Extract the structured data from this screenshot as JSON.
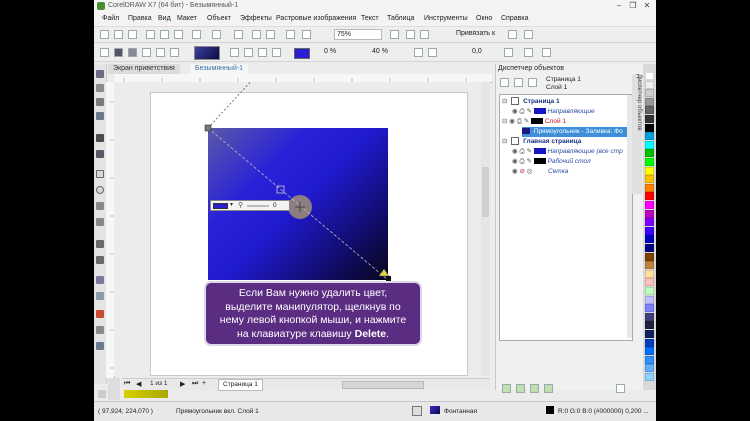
{
  "window": {
    "title": "CorelDRAW X7 (64 бит) - Безымянный-1",
    "controls": [
      "–",
      "❐",
      "✕"
    ]
  },
  "menu": [
    "Файл",
    "Правка",
    "Вид",
    "Макет",
    "Объект",
    "Эффекты",
    "Растровые изображения",
    "Текст",
    "Таблица",
    "Инструменты",
    "Окно",
    "Справка"
  ],
  "toolbar": {
    "zoom": "75%",
    "snap_label": "Привязать к",
    "angle": "0,0",
    "transparency_pct": "0 %",
    "midpoint_pct": "40 %"
  },
  "tabs": [
    "Экран приветствия",
    "Безымянный-1"
  ],
  "canvas": {
    "interactive_value": "0",
    "tooltip_lines": [
      "Если Вам нужно удалить цвет,",
      "выделите манипулятор, щелкнув по",
      "нему левой кнопкой мыши, и нажмите",
      "на клавиатуре клавишу"
    ],
    "tooltip_key": "Delete",
    "tooltip_end": "."
  },
  "navigator": {
    "page_count": "1 из 1",
    "page_tab": "Страница 1"
  },
  "docker": {
    "title": "Диспетчер объектов",
    "page_header": "Страница 1",
    "layer_header": "Слой 1",
    "vertical_tab": "Диспетчер объектов",
    "tree": [
      {
        "label": "Страница 1",
        "bold": true,
        "color": "#1a2f80"
      },
      {
        "label": "Направляющие",
        "italic": true,
        "color": "#2b4aa8",
        "swatch": "#1616c9"
      },
      {
        "label": "Слой 1",
        "color": "#c8102e",
        "swatch": "#000000"
      },
      {
        "label": "Прямоугольник - Заливка: Фо",
        "color": "#ffffff",
        "selected": true
      },
      {
        "label": "Главная страница",
        "bold": true,
        "color": "#1a2f80"
      },
      {
        "label": "Направляющие (все стр",
        "italic": true,
        "color": "#2b4aa8",
        "swatch": "#1616c9"
      },
      {
        "label": "Рабочий стол",
        "italic": true,
        "color": "#2b4aa8",
        "swatch": "#000000"
      },
      {
        "label": "Сетка",
        "italic": true,
        "color": "#2b4aa8"
      }
    ]
  },
  "palette": [
    "#ffffff",
    "#eeeeee",
    "#cccccc",
    "#999999",
    "#666666",
    "#333333",
    "#000000",
    "#00a0e3",
    "#00ffff",
    "#00c000",
    "#00ff00",
    "#ffff00",
    "#ffc000",
    "#ff8000",
    "#ff0000",
    "#ff00ff",
    "#c000c0",
    "#8000ff",
    "#4000ff",
    "#0000c0",
    "#000080",
    "#804000",
    "#c08040",
    "#ffe0a0",
    "#ffc0c0",
    "#c0ffc0",
    "#c0c0ff",
    "#8080ff",
    "#404080",
    "#202040",
    "#102060",
    "#0040c0",
    "#0070ff",
    "#3090ff",
    "#60b0ff",
    "#90d0ff"
  ],
  "status": {
    "coords": "( 97,924; 224,070 )",
    "object_info": "Прямоугольник вкл. Слой 1",
    "fill_label": "Фонтанная",
    "outline_info": "R:0 G:0 B:0 (#000000)  0,200 ..."
  }
}
